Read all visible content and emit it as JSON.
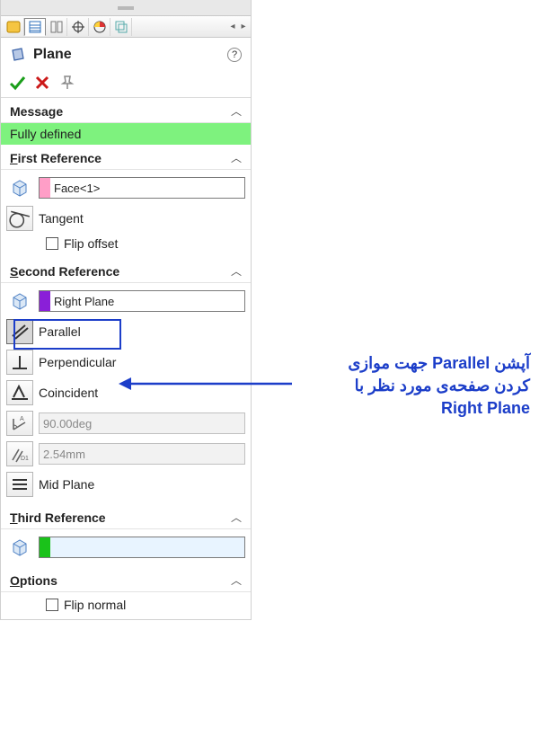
{
  "title": "Plane",
  "message_header": "Message",
  "message_value": "Fully defined",
  "first_ref": {
    "header": "First Reference",
    "value": "Face<1>",
    "tangent_label": "Tangent",
    "flip_offset_label": "Flip offset"
  },
  "second_ref": {
    "header": "Second Reference",
    "value": "Right Plane",
    "parallel_label": "Parallel",
    "perpendicular_label": "Perpendicular",
    "coincident_label": "Coincident",
    "angle_value": "90.00deg",
    "distance_value": "2.54mm",
    "midplane_label": "Mid Plane"
  },
  "third_ref": {
    "header": "Third Reference",
    "value": ""
  },
  "options": {
    "header": "Options",
    "flip_normal_label": "Flip normal"
  },
  "annotation": {
    "line1": "آپشن Parallel جهت موازی",
    "line2": "کردن صفحه‌ی مورد نظر با",
    "line3": "Right Plane"
  }
}
